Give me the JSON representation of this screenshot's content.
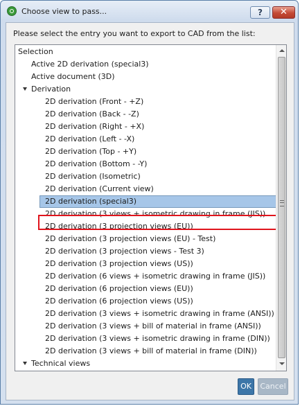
{
  "window": {
    "title": "Choose view to pass...",
    "help_label": "?",
    "close_label": "✕"
  },
  "prompt": "Please select the entry you want to export to CAD from the list:",
  "tree": {
    "items": [
      {
        "label": "Selection",
        "level": 0,
        "toggle": "none"
      },
      {
        "label": "Active 2D derivation (special3)",
        "level": 1,
        "toggle": "none"
      },
      {
        "label": "Active document (3D)",
        "level": 1,
        "toggle": "none"
      },
      {
        "label": "Derivation",
        "level": 1,
        "toggle": "expanded"
      },
      {
        "label": "2D derivation (Front - +Z)",
        "level": 2,
        "toggle": "none"
      },
      {
        "label": "2D derivation (Back - -Z)",
        "level": 2,
        "toggle": "none"
      },
      {
        "label": "2D derivation (Right - +X)",
        "level": 2,
        "toggle": "none"
      },
      {
        "label": "2D derivation (Left - -X)",
        "level": 2,
        "toggle": "none"
      },
      {
        "label": "2D derivation (Top - +Y)",
        "level": 2,
        "toggle": "none"
      },
      {
        "label": "2D derivation (Bottom - -Y)",
        "level": 2,
        "toggle": "none"
      },
      {
        "label": "2D derivation (Isometric)",
        "level": 2,
        "toggle": "none"
      },
      {
        "label": "2D derivation (Current view)",
        "level": 2,
        "toggle": "none"
      },
      {
        "label": "2D derivation (special3)",
        "level": 2,
        "toggle": "none",
        "selected": true
      },
      {
        "label": "2D derivation (3 views + isometric drawing in frame (JIS))",
        "level": 2,
        "toggle": "none"
      },
      {
        "label": "2D derivation (3 projection views (EU))",
        "level": 2,
        "toggle": "none"
      },
      {
        "label": "2D derivation (3 projection views (EU) - Test)",
        "level": 2,
        "toggle": "none"
      },
      {
        "label": "2D derivation (3 projection views - Test 3)",
        "level": 2,
        "toggle": "none"
      },
      {
        "label": "2D derivation (3 projection views (US))",
        "level": 2,
        "toggle": "none"
      },
      {
        "label": "2D derivation (6 views + isometric drawing in frame (JIS))",
        "level": 2,
        "toggle": "none"
      },
      {
        "label": "2D derivation (6 projection views (EU))",
        "level": 2,
        "toggle": "none"
      },
      {
        "label": "2D derivation (6 projection views (US))",
        "level": 2,
        "toggle": "none"
      },
      {
        "label": "2D derivation (3 views + isometric drawing in frame (ANSI))",
        "level": 2,
        "toggle": "none"
      },
      {
        "label": "2D derivation (3 views + bill of material in frame (ANSI))",
        "level": 2,
        "toggle": "none"
      },
      {
        "label": "2D derivation (3 views + isometric drawing in frame (DIN))",
        "level": 2,
        "toggle": "none"
      },
      {
        "label": "2D derivation (3 views + bill of material in frame (DIN))",
        "level": 2,
        "toggle": "none"
      },
      {
        "label": "Technical views",
        "level": 1,
        "toggle": "expanded"
      }
    ]
  },
  "buttons": {
    "ok_label": "OK",
    "cancel_label": "Cancel"
  },
  "colors": {
    "selection": "#a6c6e8",
    "highlight_border": "#e0141c",
    "ok_button": "#3d76a8"
  },
  "icons": {
    "app": "app-icon",
    "help": "help-icon",
    "close": "close-icon",
    "tree_toggle": "triangle-down-icon"
  }
}
